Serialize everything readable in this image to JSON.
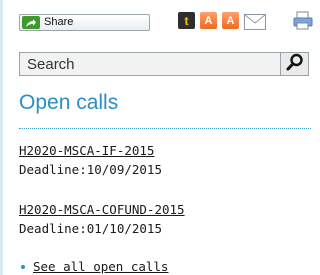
{
  "share": {
    "label": "Share"
  },
  "social_icons": [
    {
      "name": "tumblr-icon",
      "glyph": "t"
    },
    {
      "name": "bookmark-a-icon",
      "glyph": "A"
    },
    {
      "name": "bookmark-a2-icon",
      "glyph": "A"
    },
    {
      "name": "mail-icon"
    },
    {
      "name": "print-icon"
    }
  ],
  "search": {
    "placeholder": "Search"
  },
  "open_calls": {
    "title": "Open calls",
    "items": [
      {
        "id": "H2020-MSCA-IF-2015",
        "deadline": "Deadline:10/09/2015"
      },
      {
        "id": "H2020-MSCA-COFUND-2015",
        "deadline": "Deadline:01/10/2015"
      }
    ],
    "see_all": "See all open calls"
  },
  "colors": {
    "accent": "#2b8ec4",
    "share_green": "#3e9a2a",
    "bookmark_orange": "#f06a1e"
  }
}
